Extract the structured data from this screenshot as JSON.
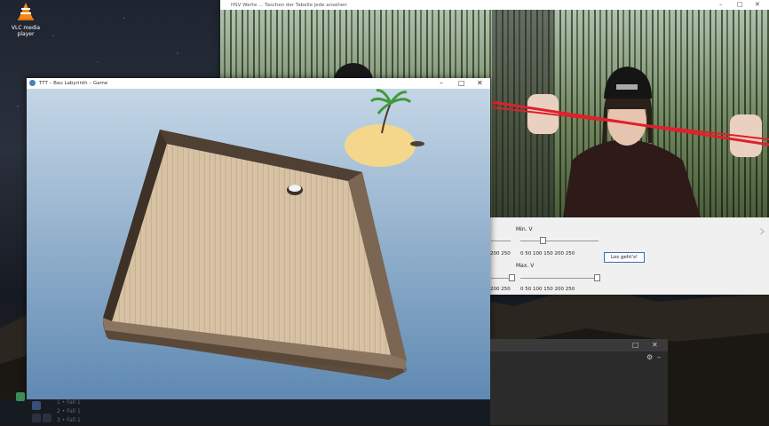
{
  "desktop": {
    "vlc_label": "VLC media player"
  },
  "hsv_window": {
    "title": "HSV Werte ... Taschen der Tabelle jede ansehen",
    "controls": {
      "min_label": "Min. V",
      "max_label": "Max. V",
      "min_ticks": "0    50   100   150   200   250",
      "max_ticks": "0    50   100   150   200   250",
      "left_min_ticks": "200   250",
      "left_max_ticks": "200   250",
      "set_button": "Los geht's!",
      "min_value": 70,
      "max_value": 250
    }
  },
  "game_window": {
    "title": "TTT – Bau Labyrinth – Game"
  },
  "taskbar": {
    "lines": [
      "1  •  Fall 1",
      "2  •  Fall 1",
      "3  •  Fall 1"
    ]
  },
  "colors": {
    "sky_top": "#c4d6e6",
    "sky_bottom": "#5f89b2",
    "wood": "#d6c0a2",
    "wood_wall": "#6c5a48",
    "laser": "#e0202a"
  }
}
